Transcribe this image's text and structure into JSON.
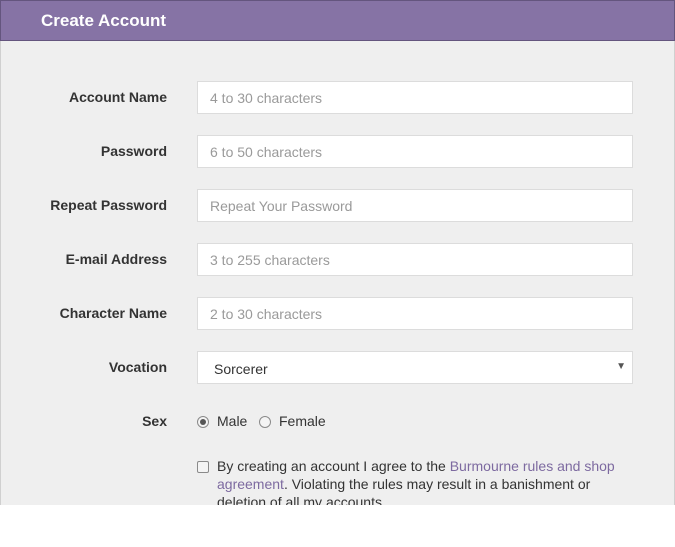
{
  "panel": {
    "title": "Create Account"
  },
  "form": {
    "fields": [
      {
        "label": "Account Name",
        "placeholder": "4 to 30 characters"
      },
      {
        "label": "Password",
        "placeholder": "6 to 50 characters"
      },
      {
        "label": "Repeat Password",
        "placeholder": "Repeat Your Password"
      },
      {
        "label": "E-mail Address",
        "placeholder": "3 to 255 characters"
      },
      {
        "label": "Character Name",
        "placeholder": "2 to 30 characters"
      }
    ],
    "vocation": {
      "label": "Vocation",
      "selected": "Sorcerer",
      "arrow": "▼"
    },
    "sex": {
      "label": "Sex",
      "options": [
        "Male",
        "Female"
      ],
      "selected": "Male"
    },
    "agreement": {
      "text_before": "By creating an account I agree to the ",
      "link_text": "Burmourne rules and shop agreement",
      "text_after": ". Violating the rules may result in a banishment or deletion of all my accounts."
    }
  },
  "colors": {
    "header": "#8673a5",
    "body": "#efefef",
    "link": "#7d6aa0"
  }
}
